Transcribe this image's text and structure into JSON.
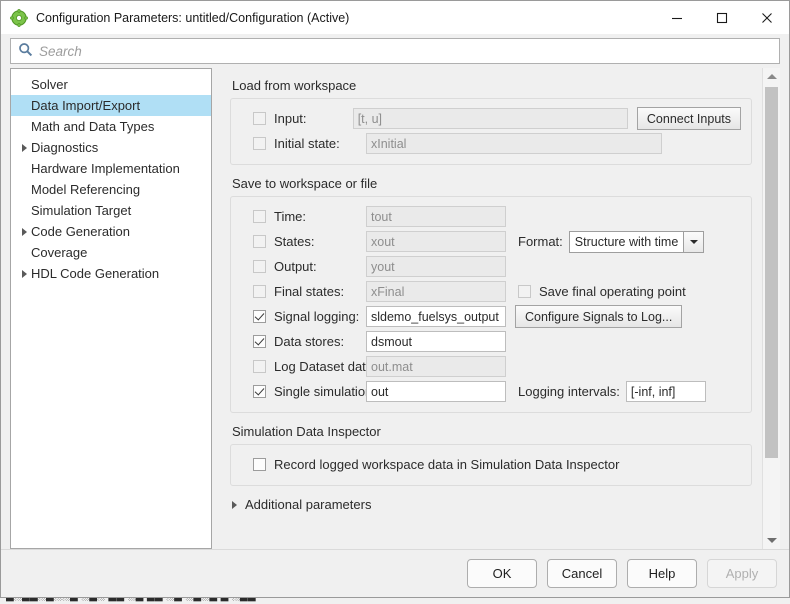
{
  "window": {
    "title": "Configuration Parameters: untitled/Configuration (Active)",
    "icon": "simulink-config-icon",
    "controls": {
      "minimize": "minimize-icon",
      "maximize": "maximize-icon",
      "close": "close-icon"
    }
  },
  "search": {
    "placeholder": "Search",
    "value": "",
    "icon": "search-icon"
  },
  "tree": {
    "items": [
      {
        "label": "Solver",
        "expandable": false,
        "selected": false
      },
      {
        "label": "Data Import/Export",
        "expandable": false,
        "selected": true
      },
      {
        "label": "Math and Data Types",
        "expandable": false,
        "selected": false
      },
      {
        "label": "Diagnostics",
        "expandable": true,
        "selected": false
      },
      {
        "label": "Hardware Implementation",
        "expandable": false,
        "selected": false
      },
      {
        "label": "Model Referencing",
        "expandable": false,
        "selected": false
      },
      {
        "label": "Simulation Target",
        "expandable": false,
        "selected": false
      },
      {
        "label": "Code Generation",
        "expandable": true,
        "selected": false
      },
      {
        "label": "Coverage",
        "expandable": false,
        "selected": false
      },
      {
        "label": "HDL Code Generation",
        "expandable": true,
        "selected": false
      }
    ]
  },
  "sections": {
    "load": {
      "title": "Load from workspace",
      "input": {
        "label": "Input:",
        "checked": false,
        "value": "[t, u]",
        "enabled": false
      },
      "initial_state": {
        "label": "Initial state:",
        "checked": false,
        "value": "xInitial",
        "enabled": false
      },
      "connect_inputs_button": "Connect Inputs"
    },
    "save": {
      "title": "Save to workspace or file",
      "time": {
        "label": "Time:",
        "checked": false,
        "value": "tout",
        "enabled": false
      },
      "states": {
        "label": "States:",
        "checked": false,
        "value": "xout",
        "enabled": false
      },
      "output": {
        "label": "Output:",
        "checked": false,
        "value": "yout",
        "enabled": false
      },
      "final_states": {
        "label": "Final states:",
        "checked": false,
        "value": "xFinal",
        "enabled": false
      },
      "signal_logging": {
        "label": "Signal logging:",
        "checked": true,
        "value": "sldemo_fuelsys_output",
        "enabled": true
      },
      "data_stores": {
        "label": "Data stores:",
        "checked": true,
        "value": "dsmout",
        "enabled": true
      },
      "log_dataset_to_file": {
        "label": "Log Dataset data to file:",
        "checked": false,
        "value": "out.mat",
        "enabled": false
      },
      "single_simulation_output": {
        "label": "Single simulation output:",
        "checked": true,
        "value": "out",
        "enabled": true
      },
      "format": {
        "label": "Format:",
        "value": "Structure with time"
      },
      "save_final_operating_point": {
        "label": "Save final operating point",
        "checked": false,
        "enabled": false
      },
      "configure_signals_button": "Configure Signals to Log...",
      "logging_intervals": {
        "label": "Logging intervals:",
        "value": "[-inf, inf]"
      }
    },
    "sdi": {
      "title": "Simulation Data Inspector",
      "record": {
        "label": "Record logged workspace data in Simulation Data Inspector",
        "checked": false
      }
    },
    "additional_parameters": {
      "label": "Additional parameters",
      "expanded": false
    }
  },
  "footer": {
    "ok": "OK",
    "cancel": "Cancel",
    "help": "Help",
    "apply": "Apply",
    "apply_enabled": false
  },
  "background": {
    "ghost_text": "█░██░█░░█ ░█░ ██ ░█ ██ ░█ ░█░█ █ ░██"
  },
  "colors": {
    "selection": "#b0dff5",
    "window_bg": "#f0f0f0",
    "title_bg": "#ffffff",
    "accent_icon": "#6cbf3f"
  }
}
